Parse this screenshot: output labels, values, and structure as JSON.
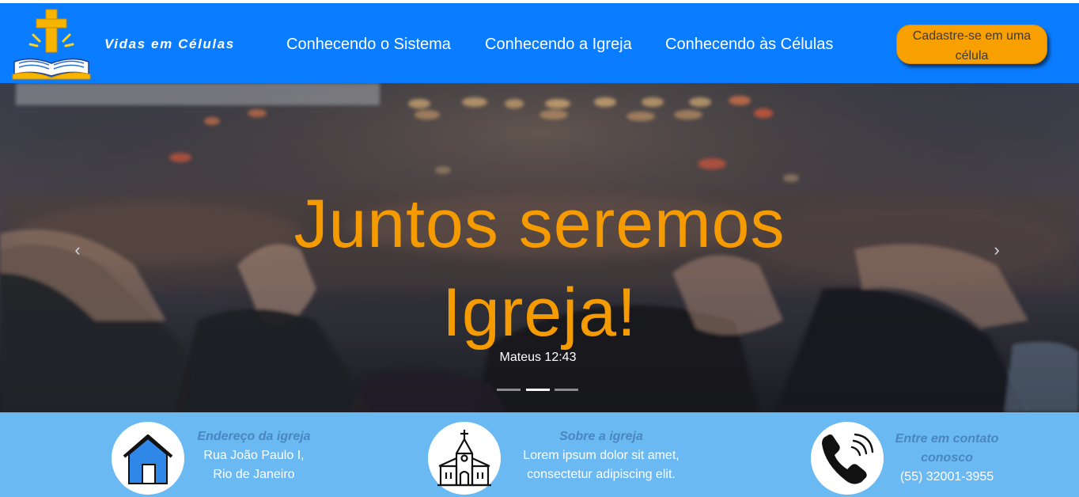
{
  "navbar": {
    "brand": "Vidas em Células",
    "logo_icon": "cross-bible-logo-icon",
    "links": [
      "Conhecendo o Sistema",
      "Conhecendo a Igreja",
      "Conhecendo às Células"
    ],
    "cta_label": "Cadastre-se em uma célula",
    "colors": {
      "background": "#0a7cff",
      "cta": "#f7a000"
    }
  },
  "carousel": {
    "title": "Juntos seremos Igreja!",
    "subtitle": "Mateus 12:43",
    "prev_icon": "chevron-left-icon",
    "next_icon": "chevron-right-icon",
    "slide_count": 3,
    "active_slide": 2,
    "title_color": "#f59b00"
  },
  "info": {
    "background": "#6ab9f2",
    "address": {
      "icon": "house-icon",
      "title": "Endereço da igreja",
      "line1": "Rua João Paulo I,",
      "line2": "Rio de Janeiro"
    },
    "about": {
      "icon": "church-icon",
      "title": "Sobre a igreja",
      "line1": "Lorem ipsum dolor sit amet,",
      "line2": "consectetur adipiscing elit."
    },
    "contact": {
      "icon": "phone-icon",
      "title": "Entre em contato conosco",
      "phone": "(55) 32001-3955"
    }
  }
}
